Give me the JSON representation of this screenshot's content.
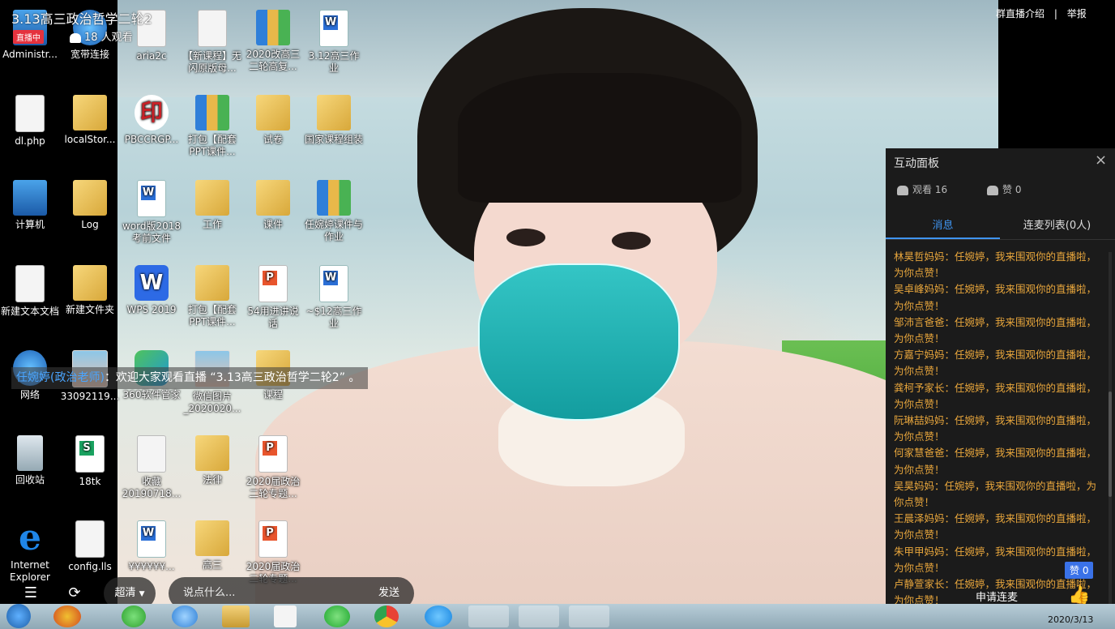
{
  "stream": {
    "title": "3.13高三政治哲学二轮2",
    "live_badge": "直播中",
    "viewers": "18 人观看"
  },
  "top_links": {
    "intro": "群直播介绍",
    "separator": "|",
    "report": "举报"
  },
  "welcome": {
    "name": "任婉婷(政治老师)",
    "text": "：欢迎大家观看直播 “3.13高三政治哲学二轮2” 。"
  },
  "desktop_icons": [
    {
      "label": "Administr...",
      "type": "pc"
    },
    {
      "label": "宽带连接",
      "type": "net"
    },
    {
      "label": "dl.php",
      "type": "doc"
    },
    {
      "label": "localStor...",
      "type": "folder"
    },
    {
      "label": "计算机",
      "type": "pc"
    },
    {
      "label": "Log",
      "type": "folder"
    },
    {
      "label": "新建文本文档",
      "type": "doc"
    },
    {
      "label": "新建文件夹",
      "type": "folder"
    },
    {
      "label": "网络",
      "type": "net"
    },
    {
      "label": "33092119...",
      "type": "photo"
    },
    {
      "label": "回收站",
      "type": "bin"
    },
    {
      "label": "18tk",
      "type": "sheet"
    },
    {
      "label": "Internet Explorer",
      "type": "ie"
    },
    {
      "label": "config.lls",
      "type": "doc"
    },
    {
      "label": "aria2c",
      "type": "doc"
    },
    {
      "label": "【新课程】无闪原版母...",
      "type": "doc"
    },
    {
      "label": "2020改高三二轮高复...",
      "type": "zip"
    },
    {
      "label": "3.12高三作业",
      "type": "word"
    },
    {
      "label": "PBCCRGP...",
      "type": "chip"
    },
    {
      "label": "打包【配套PPT课件...",
      "type": "zip"
    },
    {
      "label": "试卷",
      "type": "folder"
    },
    {
      "label": "国家课程组装",
      "type": "folder"
    },
    {
      "label": "word版2018考前文件",
      "type": "word"
    },
    {
      "label": "工作",
      "type": "folder"
    },
    {
      "label": "课件",
      "type": "folder"
    },
    {
      "label": "任婉婷课件与作业",
      "type": "zip"
    },
    {
      "label": "WPS 2019",
      "type": "wps"
    },
    {
      "label": "打包【配套PPT课件...",
      "type": "folder"
    },
    {
      "label": "54用进讲说话",
      "type": "ppt"
    },
    {
      "label": "~$12高三作业",
      "type": "word"
    },
    {
      "label": "360软件管家",
      "type": "app360"
    },
    {
      "label": "微信图片_2020020...",
      "type": "photo"
    },
    {
      "label": "课程",
      "type": "folder"
    },
    {
      "label": "收藏20190718...",
      "type": "doc"
    },
    {
      "label": "法律",
      "type": "folder"
    },
    {
      "label": "2020届政治二轮专题...",
      "type": "ppt"
    },
    {
      "label": "¥¥¥¥¥¥...",
      "type": "word"
    },
    {
      "label": "高三",
      "type": "folder"
    },
    {
      "label": "2020届政治二轮专题...",
      "type": "ppt"
    }
  ],
  "panel": {
    "title": "互动面板",
    "close_icon": "×",
    "watch_label": "观看 16",
    "like_label": "赞 0",
    "tabs": [
      {
        "label": "消息",
        "active": true
      },
      {
        "label": "连麦列表(0人)",
        "active": false
      }
    ],
    "messages": [
      "林昊哲妈妈：任婉婷，我来围观你的直播啦，为你点赞！",
      "吴卓峰妈妈：任婉婷，我来围观你的直播啦，为你点赞！",
      "邹沛言爸爸：任婉婷，我来围观你的直播啦，为你点赞！",
      "方嘉宁妈妈：任婉婷，我来围观你的直播啦，为你点赞！",
      "龚柯予家长：任婉婷，我来围观你的直播啦，为你点赞！",
      "阮琳喆妈妈：任婉婷，我来围观你的直播啦，为你点赞！",
      "何家慧爸爸：任婉婷，我来围观你的直播啦，为你点赞！",
      "吴昊妈妈：任婉婷，我来围观你的直播啦，为你点赞！",
      "王晨泽妈妈：任婉婷，我来围观你的直播啦，为你点赞！",
      "朱甲甲妈妈：任婉婷，我来围观你的直播啦，为你点赞！",
      "卢静萱家长：任婉婷，我来围观你的直播啦，为你点赞！"
    ],
    "like_badge": "赞 0",
    "apply_button": "申请连麦",
    "thumb_icon": "👍"
  },
  "controls": {
    "quality": "超清",
    "chat_placeholder": "说点什么...",
    "send": "发送"
  },
  "taskbar": {
    "date": "2020/3/13"
  },
  "colors": {
    "accent": "#3f94f0",
    "message": "#e8a63c",
    "live": "#e5323e",
    "panel_bg": "#1b1b1b"
  }
}
